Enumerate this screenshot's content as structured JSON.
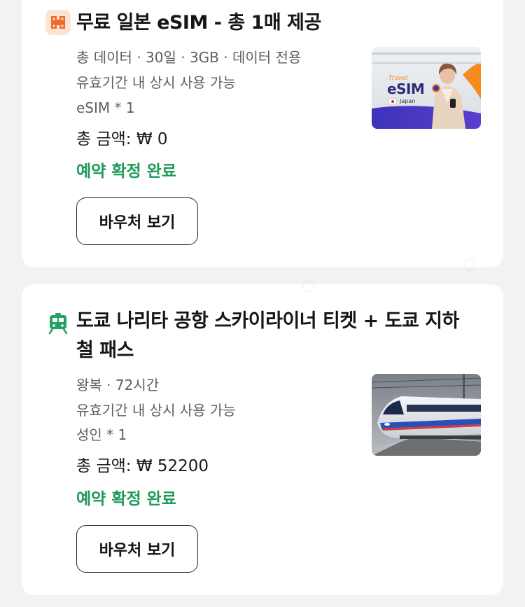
{
  "bookings": [
    {
      "title": "무료 일본 eSIM - 총 1매 제공",
      "icon": "ticket-icon",
      "details": [
        "총 데이터 · 30일 · 3GB · 데이터 전용",
        "유효기간 내 상시 사용 가능",
        "eSIM * 1"
      ],
      "price": "총 금액: ₩ 0",
      "status": "예약 확정 완료",
      "button_label": "바우처 보기",
      "thumbnail": {
        "small_text": "Travel",
        "brand": "eSIM",
        "country": "Japan"
      }
    },
    {
      "title": "도쿄 나리타 공항 스카이라이너 티켓 + 도쿄 지하철 패스",
      "icon": "train-icon",
      "details": [
        "왕복 · 72시간",
        "유효기간 내 상시 사용 가능",
        "성인 * 1"
      ],
      "price": "총 금액: ₩ 52200",
      "status": "예약 확정 완료",
      "button_label": "바우처 보기"
    }
  ],
  "colors": {
    "background": "#f2f2f4",
    "status_green": "#1f9a5a",
    "esim_icon_orange": "#f26a2e",
    "train_icon_green": "#21a366"
  }
}
